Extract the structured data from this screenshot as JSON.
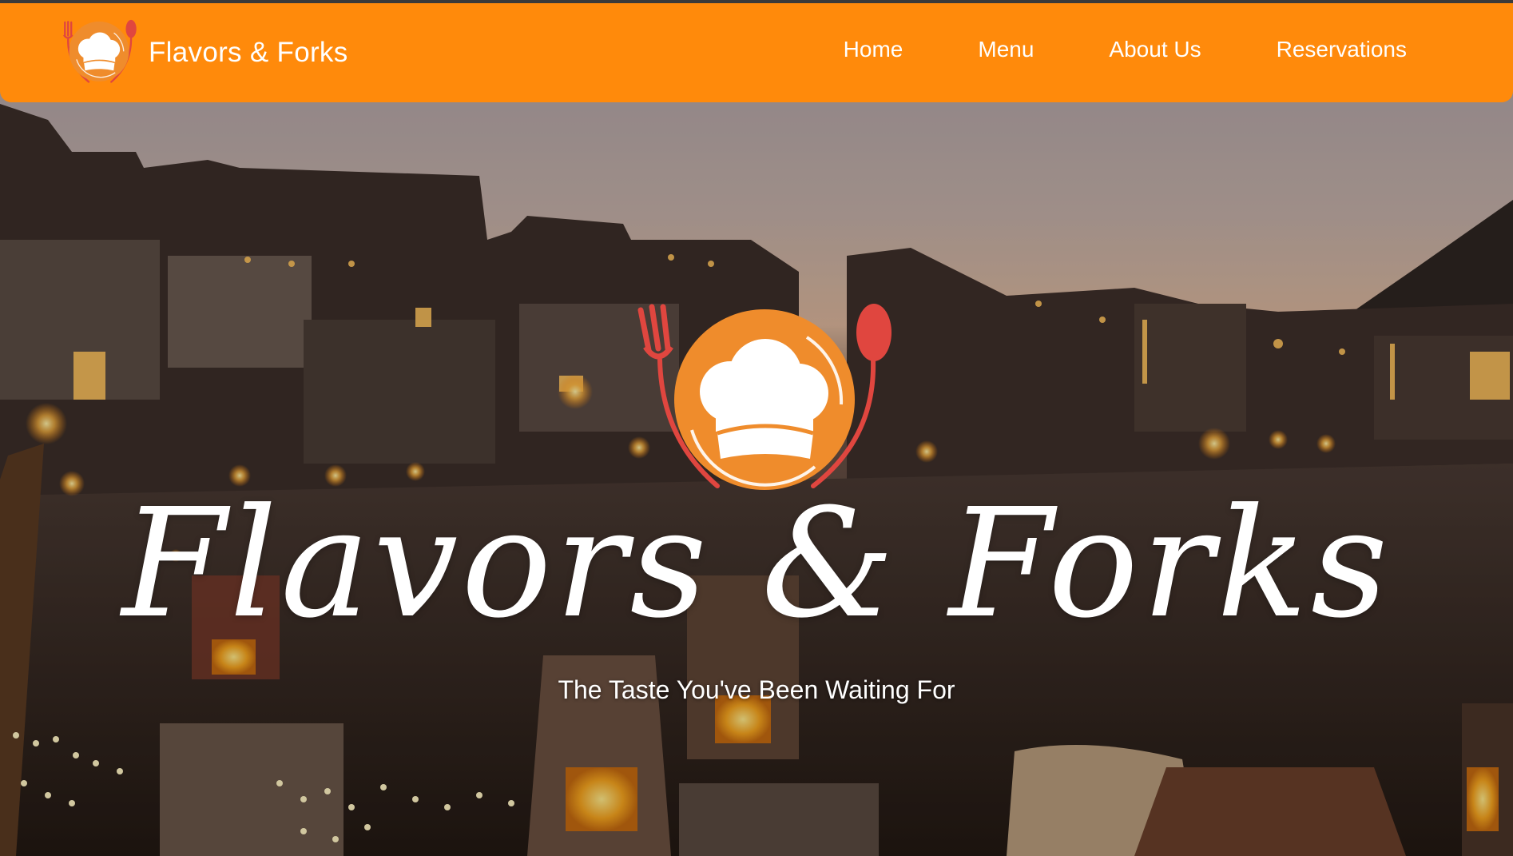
{
  "nav": {
    "brand_name": "Flavors & Forks",
    "brand_logo_icon": "chef-hat-fork-spoon-icon",
    "links": [
      {
        "label": "Home"
      },
      {
        "label": "Menu"
      },
      {
        "label": "About Us"
      },
      {
        "label": "Reservations"
      }
    ]
  },
  "hero": {
    "logo_icon": "chef-hat-fork-spoon-icon",
    "title": "Flavors & Forks",
    "subtitle": "The Taste You've Been Waiting For",
    "background": "evening-beachfront-dining-photo"
  },
  "colors": {
    "nav_background": "#ff8a0b",
    "logo_plate": "#ef8c2c",
    "logo_utensils": "#e0463f",
    "text": "#ffffff"
  }
}
